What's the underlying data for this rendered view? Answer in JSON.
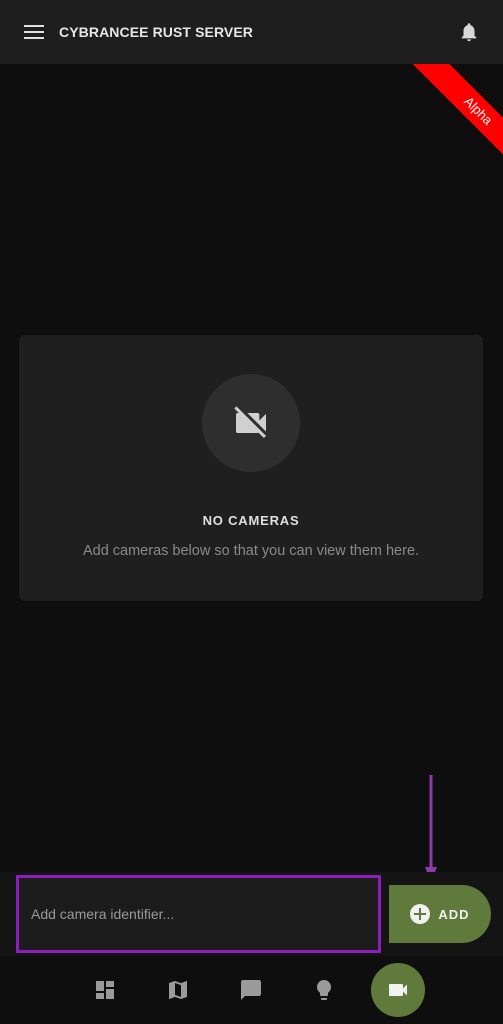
{
  "header": {
    "title": "CYBRANCEE RUST SERVER",
    "menu_icon": "hamburger-menu-icon",
    "notification_icon": "bell-icon"
  },
  "ribbon": {
    "label": "Alpha",
    "color": "#ff0000"
  },
  "empty_state": {
    "icon": "video-off-icon",
    "title": "NO CAMERAS",
    "description": "Add cameras below so that you can view them here."
  },
  "camera_input": {
    "value": "",
    "placeholder": "Add camera identifier..."
  },
  "add_button": {
    "label": "ADD",
    "icon": "plus-circle-icon"
  },
  "bottom_nav": {
    "items": [
      {
        "icon": "dashboard-icon",
        "active": false
      },
      {
        "icon": "map-icon",
        "active": false
      },
      {
        "icon": "chat-icon",
        "active": false
      },
      {
        "icon": "lightbulb-icon",
        "active": false
      },
      {
        "icon": "video-camera-icon",
        "active": true
      }
    ]
  },
  "colors": {
    "accent": "#5f7a3a",
    "highlight": "#8e1dbb",
    "background": "#0e0e0e"
  }
}
